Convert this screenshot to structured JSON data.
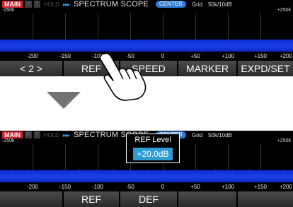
{
  "top_screen": {
    "status": {
      "main": "MAIN",
      "r": "R",
      "t": "T",
      "hold": "HOLD",
      "arrows": "▸▸▸",
      "title": "SPECTRUM SCOPE",
      "center": "CENTER",
      "grid": "Grid",
      "grid_value": "50k/10dB"
    },
    "span_left": "-250k",
    "span_right": "+250k",
    "freq_labels": [
      "-200",
      "-150",
      "-100",
      "-50",
      "0",
      "+50",
      "+100",
      "+150",
      "+200"
    ],
    "softkeys": [
      "< 2 >",
      "REF",
      "SPEED",
      "MARKER",
      "EXPD/SET"
    ]
  },
  "bottom_screen": {
    "status": {
      "main": "MAIN",
      "r": "R",
      "t": "T",
      "hold": "HOLD",
      "arrows": "▸▸▸",
      "title": "SPECTRUM SCOPE",
      "center": "CENTER",
      "grid": "Grid",
      "grid_value": "50k/10dB"
    },
    "span_left": "-250k",
    "span_right": "+250k",
    "freq_labels": [
      "-200",
      "-150",
      "-100",
      "-50",
      "0",
      "+50",
      "+100",
      "+150",
      "+200"
    ],
    "softkeys": [
      "",
      "REF",
      "DEF",
      "",
      ""
    ],
    "ref_popup": {
      "label": "REF Level",
      "value": "+20.0dB"
    }
  },
  "colors": {
    "main_badge": "#d21f2a",
    "center_badge": "#2d7bd6",
    "waterfall": "#1e3fe8",
    "arrows": "#2ea1ff",
    "ref_value_bg": "#2e9bd5"
  },
  "icons": {
    "transition": "down-arrow-icon",
    "touch": "hand-pointer-icon"
  }
}
